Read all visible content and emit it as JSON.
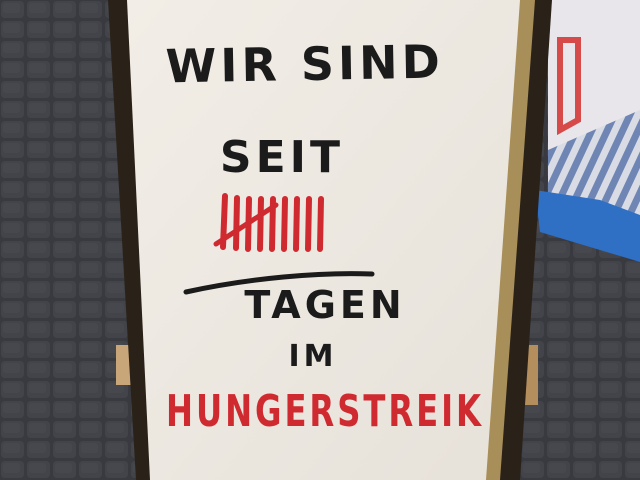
{
  "sign": {
    "line1": "WIR SIND",
    "line2": "SEIT",
    "line4": "TAGEN",
    "line5": "IM",
    "line6": "HUNGERSTREIK"
  },
  "tally": {
    "count": 9,
    "crossed": true
  },
  "colors": {
    "ink_black": "#1b1b1b",
    "ink_red": "#cf2a30",
    "paper": "#efebe4",
    "board": "#2a2219",
    "pavement": "#404348",
    "tarp_blue": "#2f6fc4"
  }
}
